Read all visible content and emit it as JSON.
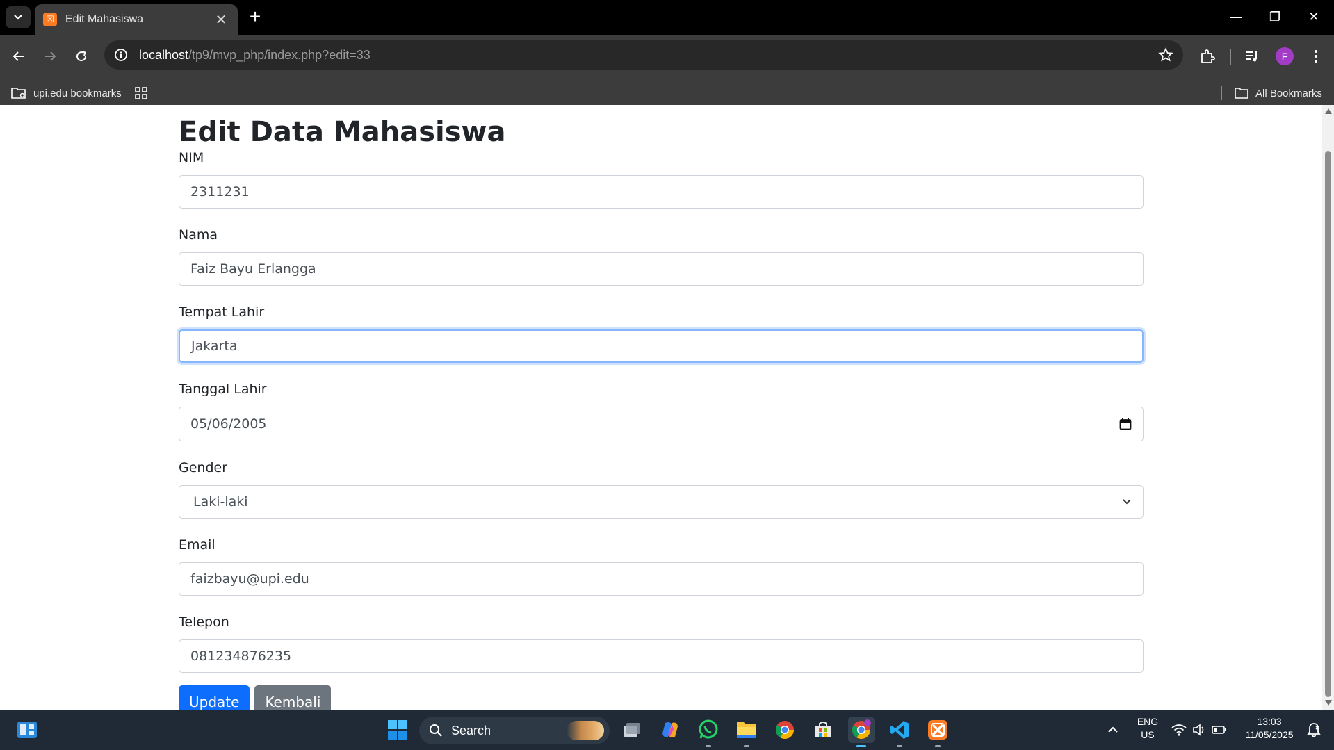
{
  "browser": {
    "tab_title": "Edit Mahasiswa",
    "tab_favicon": "xampp-icon",
    "url_host": "localhost",
    "url_path": "/tp9/mvp_php/index.php?edit=33",
    "profile_initial": "F",
    "bookmarks": {
      "left_item": "upi.edu bookmarks",
      "right_item": "All Bookmarks"
    }
  },
  "page": {
    "heading": "Edit Data Mahasiswa",
    "fields": {
      "nim": {
        "label": "NIM",
        "value": "2311231"
      },
      "nama": {
        "label": "Nama",
        "value": "Faiz Bayu Erlangga"
      },
      "tempat_lahir": {
        "label": "Tempat Lahir",
        "value": "Jakarta"
      },
      "tanggal_lahir": {
        "label": "Tanggal Lahir",
        "value": "05/06/2005"
      },
      "gender": {
        "label": "Gender",
        "value": "Laki-laki"
      },
      "email": {
        "label": "Email",
        "value": "faizbayu@upi.edu"
      },
      "telepon": {
        "label": "Telepon",
        "value": "081234876235"
      }
    },
    "buttons": {
      "update": "Update",
      "kembali": "Kembali"
    }
  },
  "taskbar": {
    "search_label": "Search",
    "language_line1": "ENG",
    "language_line2": "US",
    "time": "13:03",
    "date": "11/05/2025"
  },
  "colors": {
    "primary": "#0d6efd",
    "secondary": "#6c757d",
    "focus_border": "#86b7fe"
  }
}
